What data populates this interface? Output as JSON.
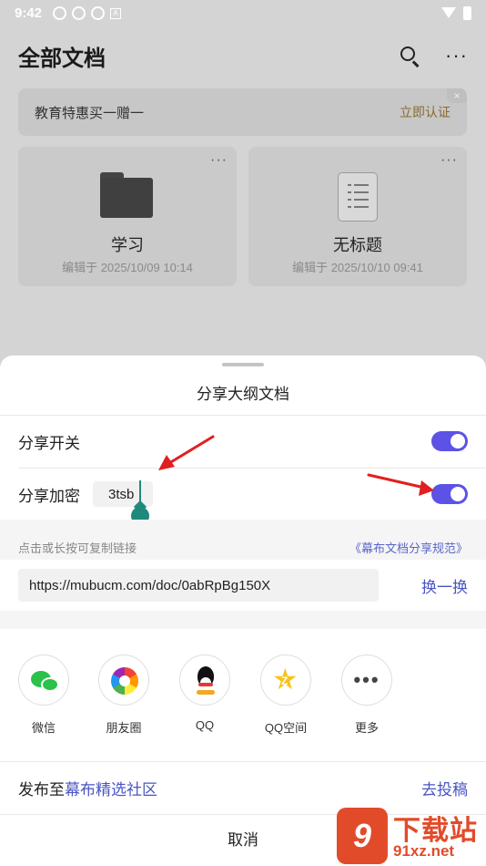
{
  "status_bar": {
    "time": "9:42"
  },
  "header": {
    "title": "全部文档"
  },
  "promo": {
    "text": "教育特惠买一赠一",
    "action": "立即认证"
  },
  "documents": [
    {
      "name": "学习",
      "edited": "编辑于 2025/10/09 10:14",
      "icon": "folder-icon"
    },
    {
      "name": "无标题",
      "edited": "编辑于 2025/10/10 09:41",
      "icon": "document-icon"
    }
  ],
  "share_sheet": {
    "title": "分享大纲文档",
    "share_toggle": {
      "label": "分享开关",
      "on": true
    },
    "password": {
      "label": "分享加密",
      "value": "3tsb",
      "on": true
    },
    "hint": "点击或长按可复制链接",
    "policy_link": "《幕布文档分享规范》",
    "url": "https://mubucm.com/doc/0abRpBg150X",
    "swap_label": "换一换",
    "targets": [
      {
        "label": "微信",
        "icon": "wechat-icon"
      },
      {
        "label": "朋友圈",
        "icon": "moments-icon"
      },
      {
        "label": "QQ",
        "icon": "qq-icon"
      },
      {
        "label": "QQ空间",
        "icon": "qzone-icon"
      },
      {
        "label": "更多",
        "icon": "more-icon"
      }
    ],
    "publish": {
      "prefix": "发布至",
      "community": "幕布精选社区",
      "action": "去投稿"
    },
    "cancel": "取消"
  },
  "watermark": {
    "title": "下载站",
    "url": "91xz.net"
  },
  "colors": {
    "toggle_on": "#5c52e6",
    "link": "#4a55c2",
    "cursor": "#1e8a7b",
    "annotation_arrow": "#e02020"
  }
}
